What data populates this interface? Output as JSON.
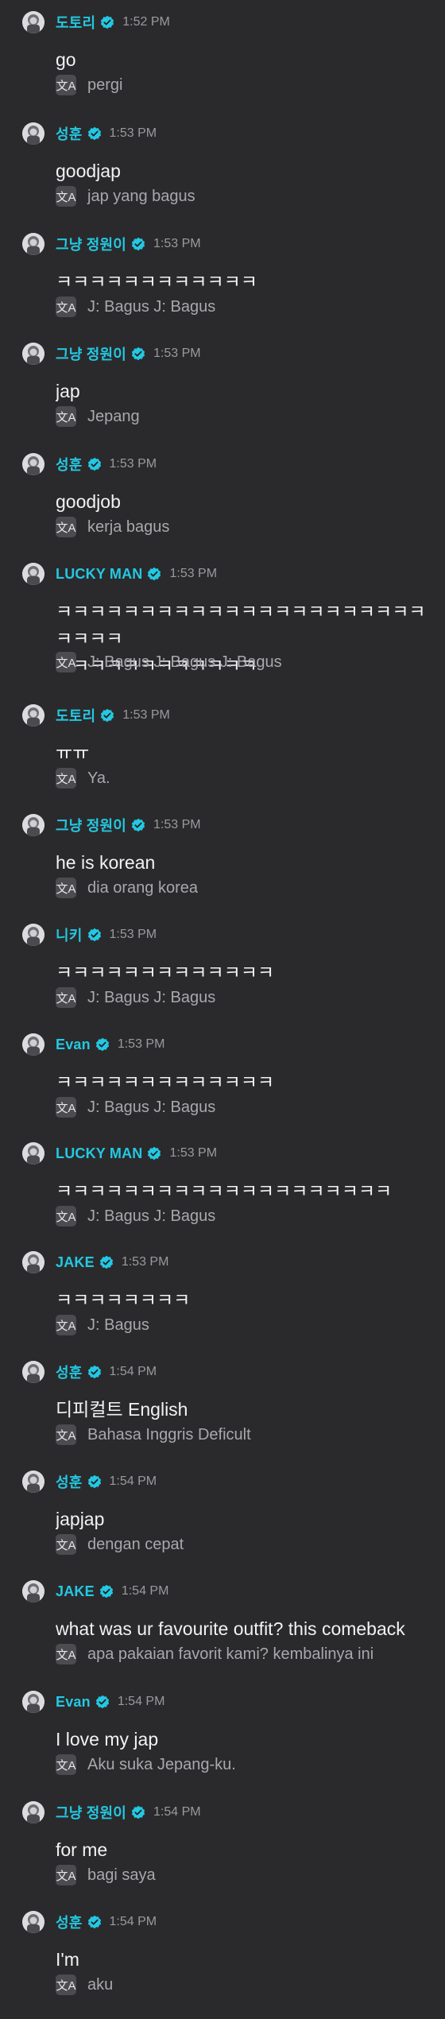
{
  "icons": {
    "avatar": "avatar-icon",
    "verified": "verified-badge-icon",
    "translate": "translate-icon"
  },
  "colors": {
    "background": "#2a2a2c",
    "username": "#24c8e2",
    "timestamp": "#9a9a9f",
    "message": "#f2f2f4",
    "translation": "#a8a8ad"
  },
  "translate_glyph": "文A",
  "messages": [
    {
      "user": "도토리",
      "time": "1:52 PM",
      "text": "go",
      "translation": "pergi"
    },
    {
      "user": "성훈",
      "time": "1:53 PM",
      "text": "goodjap",
      "translation": "jap yang bagus"
    },
    {
      "user": "그냥 정원이",
      "time": "1:53 PM",
      "text": "ㅋㅋㅋㅋㅋㅋㅋㅋㅋㅋㅋㅋ",
      "translation": "J: Bagus J: Bagus"
    },
    {
      "user": "그냥 정원이",
      "time": "1:53 PM",
      "text": "jap",
      "translation": "Jepang"
    },
    {
      "user": "성훈",
      "time": "1:53 PM",
      "text": "goodjob",
      "translation": "kerja bagus"
    },
    {
      "user": "LUCKY MAN",
      "time": "1:53 PM",
      "text": "ㅋㅋㅋㅋㅋㅋㅋㅋㅋㅋㅋㅋㅋㅋㅋㅋㅋㅋㅋㅋㅋㅋㅋㅋㅋㅋ\nㅋㅋㅋㅋㅋㅋㅋㅋㅋㅋㅋㅋ",
      "translation": "J: Bagus J: Bagus J: Bagus"
    },
    {
      "user": "도토리",
      "time": "1:53 PM",
      "text": "ㅠㅠ",
      "translation": "Ya."
    },
    {
      "user": "그냥 정원이",
      "time": "1:53 PM",
      "text": "he is korean",
      "translation": "dia orang korea"
    },
    {
      "user": "니키",
      "time": "1:53 PM",
      "text": "ㅋㅋㅋㅋㅋㅋㅋㅋㅋㅋㅋㅋㅋ",
      "translation": "J: Bagus J: Bagus"
    },
    {
      "user": "Evan",
      "time": "1:53 PM",
      "text": "ㅋㅋㅋㅋㅋㅋㅋㅋㅋㅋㅋㅋㅋ",
      "translation": "J: Bagus J: Bagus"
    },
    {
      "user": "LUCKY MAN",
      "time": "1:53 PM",
      "text": "ㅋㅋㅋㅋㅋㅋㅋㅋㅋㅋㅋㅋㅋㅋㅋㅋㅋㅋㅋㅋ",
      "translation": "J: Bagus J: Bagus"
    },
    {
      "user": "JAKE",
      "time": "1:53 PM",
      "text": "ㅋㅋㅋㅋㅋㅋㅋㅋ",
      "translation": "J: Bagus"
    },
    {
      "user": "성훈",
      "time": "1:54 PM",
      "text": "디피컬트 English",
      "translation": "Bahasa Inggris Deficult"
    },
    {
      "user": "성훈",
      "time": "1:54 PM",
      "text": "japjap",
      "translation": "dengan cepat"
    },
    {
      "user": "JAKE",
      "time": "1:54 PM",
      "text": "what was ur favourite outfit? this comeback",
      "translation": "apa pakaian favorit kami? kembalinya ini"
    },
    {
      "user": "Evan",
      "time": "1:54 PM",
      "text": "I love my jap",
      "translation": "Aku suka Jepang-ku."
    },
    {
      "user": "그냥 정원이",
      "time": "1:54 PM",
      "text": "for me",
      "translation": "bagi saya"
    },
    {
      "user": "성훈",
      "time": "1:54 PM",
      "text": "I'm",
      "translation": "aku"
    }
  ]
}
